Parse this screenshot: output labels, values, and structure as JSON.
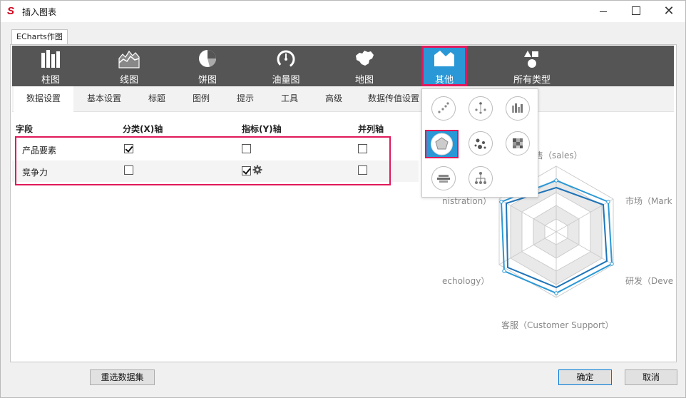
{
  "window": {
    "title": "插入图表",
    "logo_text": "S",
    "minimize": "minimize",
    "maximize": "maximize",
    "close": "✕"
  },
  "outer_tab": {
    "label": "ECharts作图"
  },
  "chart_types": [
    {
      "label": "柱图",
      "icon": "bar-chart-icon"
    },
    {
      "label": "线图",
      "icon": "line-chart-icon"
    },
    {
      "label": "饼图",
      "icon": "pie-chart-icon"
    },
    {
      "label": "油量图",
      "icon": "gauge-icon"
    },
    {
      "label": "地图",
      "icon": "map-icon"
    },
    {
      "label": "其他",
      "icon": "other-chart-icon",
      "active": true
    },
    {
      "label": "所有类型",
      "icon": "all-types-icon"
    }
  ],
  "sub_tabs": [
    {
      "label": "数据设置",
      "active": true
    },
    {
      "label": "基本设置"
    },
    {
      "label": "标题"
    },
    {
      "label": "图例"
    },
    {
      "label": "提示"
    },
    {
      "label": "工具"
    },
    {
      "label": "高级"
    },
    {
      "label": "数据传值设置"
    }
  ],
  "field_table": {
    "headers": [
      "字段",
      "分类(X)轴",
      "指标(Y)轴",
      "并列轴"
    ],
    "rows": [
      {
        "field": "产品要素",
        "x_axis": true,
        "y_axis": false,
        "parallel": false
      },
      {
        "field": "竞争力",
        "x_axis": false,
        "y_axis": true,
        "parallel": false
      }
    ]
  },
  "radar_preview": {
    "labels": [
      "售（sales）",
      "市场（Mark",
      "研发（Deve",
      "客服（Customer Support）",
      "echology）",
      "nistration）"
    ],
    "colors": {
      "series1": "#2a98d6",
      "series2": "#1f74b8",
      "grid": "#cccccc",
      "band": "#e9e9e9"
    }
  },
  "other_dropdown": {
    "items": [
      "scatter-icon",
      "tree-scatter-icon",
      "mixed-bar-icon",
      "radar-icon",
      "bubble-icon",
      "heatmap-icon",
      "wordcloud-icon",
      "tree-icon"
    ],
    "selected": "radar-icon"
  },
  "buttons": {
    "reselect": "重选数据集",
    "ok": "确定",
    "cancel": "取消"
  },
  "colors": {
    "accent": "#2a98d6",
    "highlight": "#e0195a",
    "toolbar_bg": "#555556"
  }
}
